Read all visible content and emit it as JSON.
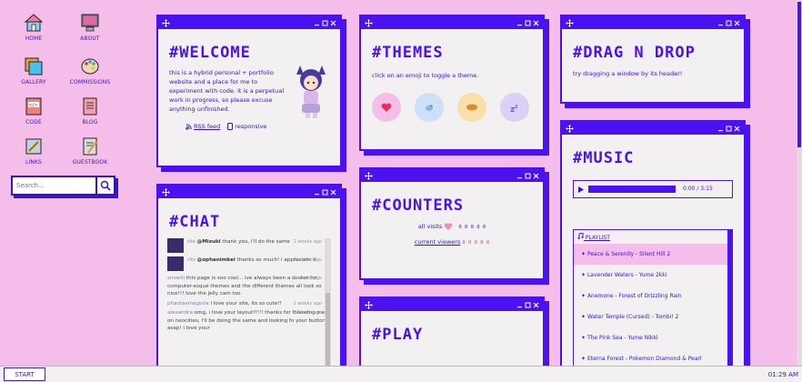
{
  "desktop": {
    "icons": [
      {
        "label": "HOME"
      },
      {
        "label": "ABOUT"
      },
      {
        "label": "GALLERY"
      },
      {
        "label": "COMMISSIONS"
      },
      {
        "label": "CODE"
      },
      {
        "label": "BLOG"
      },
      {
        "label": "LINKS"
      },
      {
        "label": "GUESTBOOK"
      }
    ],
    "search_placeholder": "Search..."
  },
  "welcome": {
    "title": "#WELCOME",
    "text": "this is a hybrid personal + portfolio website and a place for me to experiment with code. it is a perpetual work in progress, so please excuse anything unfinished.",
    "rss": "RSS feed",
    "responsive": "responsive"
  },
  "themes": {
    "title": "#THEMES",
    "text": "click on an emoji to toggle a theme.",
    "buttons": [
      {
        "icon": "heart",
        "color": "#f5bde9"
      },
      {
        "icon": "bird",
        "color": "#cde0f5"
      },
      {
        "icon": "bread",
        "color": "#f9dfa8"
      },
      {
        "icon": "zzz",
        "color": "#ddd0f5"
      }
    ]
  },
  "dragndrop": {
    "title": "#DRAG N DROP",
    "text": "try dragging a window by its header!"
  },
  "chat": {
    "title": "#CHAT",
    "messages": [
      {
        "name": "rilo",
        "mention": "@Mizuki",
        "text": "thank you, i'll do the same",
        "time": "2 weeks ago"
      },
      {
        "name": "rilo",
        "mention": "@ophanimkei",
        "text": "thanks so much! i appreciate it",
        "time": "2 weeks ago"
      },
      {
        "name": "snowiii",
        "mention": "",
        "text": "this page is soo cool... ive always been a sucker for computer-esque themes and the different themes all look so nice!!! love the jelly cam too",
        "time": "2 weeks ago"
      },
      {
        "name": "phantasmagoria",
        "mention": "",
        "text": "i love your site, its so cute!!",
        "time": "2 weeks ago"
      },
      {
        "name": "alexandra",
        "mention": "",
        "text": "omg, i love your layout!!!!! thanks for following me on neocities, i'll be doing the same and looking fo your button asap! i love your",
        "time": "2 weeks ago"
      }
    ]
  },
  "counters": {
    "title": "#COUNTERS",
    "visits_label": "all visits",
    "visits_value": "0 0 0 0 0",
    "viewers_label": "current viewers",
    "viewers_value": "0 0 0 0 0"
  },
  "play": {
    "title": "#PLAY"
  },
  "music": {
    "title": "#MUSIC",
    "time": "0:00 / 3:15",
    "playlist_label": "PLAYLIST",
    "tracks": [
      "Peace & Serenity - Silent Hill 2",
      "Lavender Waters - Yume 2kki",
      "Anemone - Forest of Drizzling Rain",
      "Water Temple (Cursed) - Tombi! 2",
      "The Pink Sea - Yume Nikki",
      "Eterna Forest - Pokemon Diamond & Pearl"
    ]
  },
  "taskbar": {
    "start": "START",
    "clock": "01:29 AM"
  },
  "colors": {
    "accent": "#4a12f0",
    "background": "#f5bde9",
    "window": "#f2f0f0"
  }
}
